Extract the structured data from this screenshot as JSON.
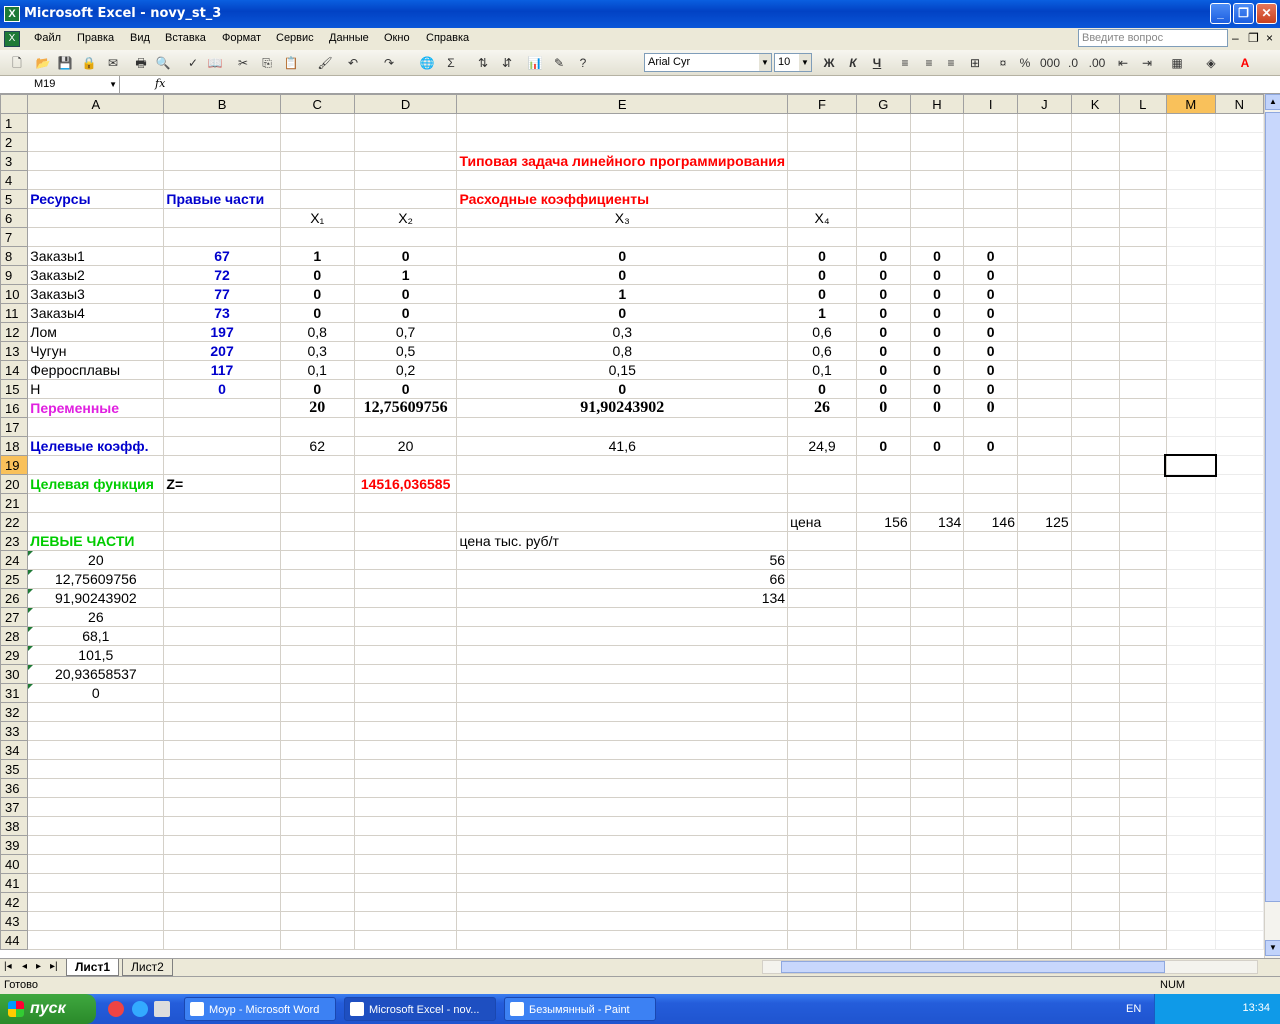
{
  "window": {
    "title": "Microsoft Excel - novy_st_3",
    "min": "_",
    "max": "❐",
    "close": "✕"
  },
  "menu": {
    "items": [
      "Файл",
      "Правка",
      "Вид",
      "Вставка",
      "Формат",
      "Сервис",
      "Данные",
      "Окно",
      "Справка"
    ],
    "ask_placeholder": "Введите вопрос"
  },
  "format": {
    "font": "Arial Cyr",
    "size": "10"
  },
  "formula": {
    "cell_ref": "M19",
    "fx": "fx",
    "content": ""
  },
  "columns": [
    "A",
    "B",
    "C",
    "D",
    "E",
    "F",
    "G",
    "H",
    "I",
    "J",
    "K",
    "L",
    "M",
    "N"
  ],
  "rows": [
    {
      "n": "1",
      "cells": {}
    },
    {
      "n": "2",
      "cells": {}
    },
    {
      "n": "3",
      "cells": {
        "E": "Типовая задача линейного программирования"
      }
    },
    {
      "n": "4",
      "cells": {}
    },
    {
      "n": "5",
      "cells": {
        "A": "Ресурсы",
        "B": "Правые  части",
        "E": "Расходные коэффициенты"
      }
    },
    {
      "n": "6",
      "cells": {
        "C": "X₁",
        "D": "X₂",
        "E": "X₃",
        "F": "X₄"
      }
    },
    {
      "n": "7",
      "cells": {}
    },
    {
      "n": "8",
      "cells": {
        "A": "Заказы1",
        "B": "67",
        "C": "1",
        "D": "0",
        "E": "0",
        "F": "0",
        "G": "0",
        "H": "0",
        "I": "0"
      }
    },
    {
      "n": "9",
      "cells": {
        "A": "Заказы2",
        "B": "72",
        "C": "0",
        "D": "1",
        "E": "0",
        "F": "0",
        "G": "0",
        "H": "0",
        "I": "0"
      }
    },
    {
      "n": "10",
      "cells": {
        "A": "Заказы3",
        "B": "77",
        "C": "0",
        "D": "0",
        "E": "1",
        "F": "0",
        "G": "0",
        "H": "0",
        "I": "0"
      }
    },
    {
      "n": "11",
      "cells": {
        "A": "Заказы4",
        "B": "73",
        "C": "0",
        "D": "0",
        "E": "0",
        "F": "1",
        "G": "0",
        "H": "0",
        "I": "0"
      }
    },
    {
      "n": "12",
      "cells": {
        "A": "Лом",
        "B": "197",
        "C": "0,8",
        "D": "0,7",
        "E": "0,3",
        "F": "0,6",
        "G": "0",
        "H": "0",
        "I": "0"
      }
    },
    {
      "n": "13",
      "cells": {
        "A": "Чугун",
        "B": "207",
        "C": "0,3",
        "D": "0,5",
        "E": "0,8",
        "F": "0,6",
        "G": "0",
        "H": "0",
        "I": "0"
      }
    },
    {
      "n": "14",
      "cells": {
        "A": "Ферросплавы",
        "B": "117",
        "C": "0,1",
        "D": "0,2",
        "E": "0,15",
        "F": "0,1",
        "G": "0",
        "H": "0",
        "I": "0"
      }
    },
    {
      "n": "15",
      "cells": {
        "A": "Н",
        "B": "0",
        "C": "0",
        "D": "0",
        "E": "0",
        "F": "0",
        "G": "0",
        "H": "0",
        "I": "0"
      }
    },
    {
      "n": "16",
      "cells": {
        "A": "Переменные",
        "C": "20",
        "D": "12,75609756",
        "E": "91,90243902",
        "F": "26",
        "G": "0",
        "H": "0",
        "I": "0"
      }
    },
    {
      "n": "17",
      "cells": {}
    },
    {
      "n": "18",
      "cells": {
        "A": "Целевые коэфф.",
        "C": "62",
        "D": "20",
        "E": "41,6",
        "F": "24,9",
        "G": "0",
        "H": "0",
        "I": "0"
      }
    },
    {
      "n": "19",
      "cells": {}
    },
    {
      "n": "20",
      "cells": {
        "A": "Целевая функция",
        "B": "Z=",
        "D": "14516,036585"
      }
    },
    {
      "n": "21",
      "cells": {}
    },
    {
      "n": "22",
      "cells": {
        "F": "цена",
        "G": "156",
        "H": "134",
        "I": "146",
        "J": "125"
      }
    },
    {
      "n": "23",
      "cells": {
        "A": "ЛЕВЫЕ ЧАСТИ",
        "E": "цена тыс. руб/т"
      }
    },
    {
      "n": "24",
      "cells": {
        "A": "20",
        "E": "56"
      }
    },
    {
      "n": "25",
      "cells": {
        "A": "12,75609756",
        "E": "66"
      }
    },
    {
      "n": "26",
      "cells": {
        "A": "91,90243902",
        "E": "134"
      }
    },
    {
      "n": "27",
      "cells": {
        "A": "26"
      }
    },
    {
      "n": "28",
      "cells": {
        "A": "68,1"
      }
    },
    {
      "n": "29",
      "cells": {
        "A": "101,5"
      }
    },
    {
      "n": "30",
      "cells": {
        "A": "20,93658537"
      }
    },
    {
      "n": "31",
      "cells": {
        "A": "0"
      }
    },
    {
      "n": "32",
      "cells": {}
    },
    {
      "n": "33",
      "cells": {}
    },
    {
      "n": "34",
      "cells": {}
    },
    {
      "n": "35",
      "cells": {}
    },
    {
      "n": "36",
      "cells": {}
    },
    {
      "n": "37",
      "cells": {}
    },
    {
      "n": "38",
      "cells": {}
    },
    {
      "n": "39",
      "cells": {}
    },
    {
      "n": "40",
      "cells": {}
    },
    {
      "n": "41",
      "cells": {}
    },
    {
      "n": "42",
      "cells": {}
    },
    {
      "n": "43",
      "cells": {}
    },
    {
      "n": "44",
      "cells": {}
    }
  ],
  "selected": {
    "col": "M",
    "row": "19"
  },
  "sheets": [
    "Лист1",
    "Лист2"
  ],
  "status": {
    "ready": "Готово",
    "num": "NUM"
  },
  "taskbar": {
    "start": "пуск",
    "tasks": [
      "Моур - Microsoft Word",
      "Microsoft Excel - nov...",
      "Безымянный - Paint"
    ],
    "lang": "EN",
    "clock": "13:34"
  },
  "colors": {
    "title_red": "#ff0000",
    "blue": "#0000cc",
    "magenta": "#e020e0",
    "green": "#00cc00",
    "selection": "#f9c15b"
  }
}
